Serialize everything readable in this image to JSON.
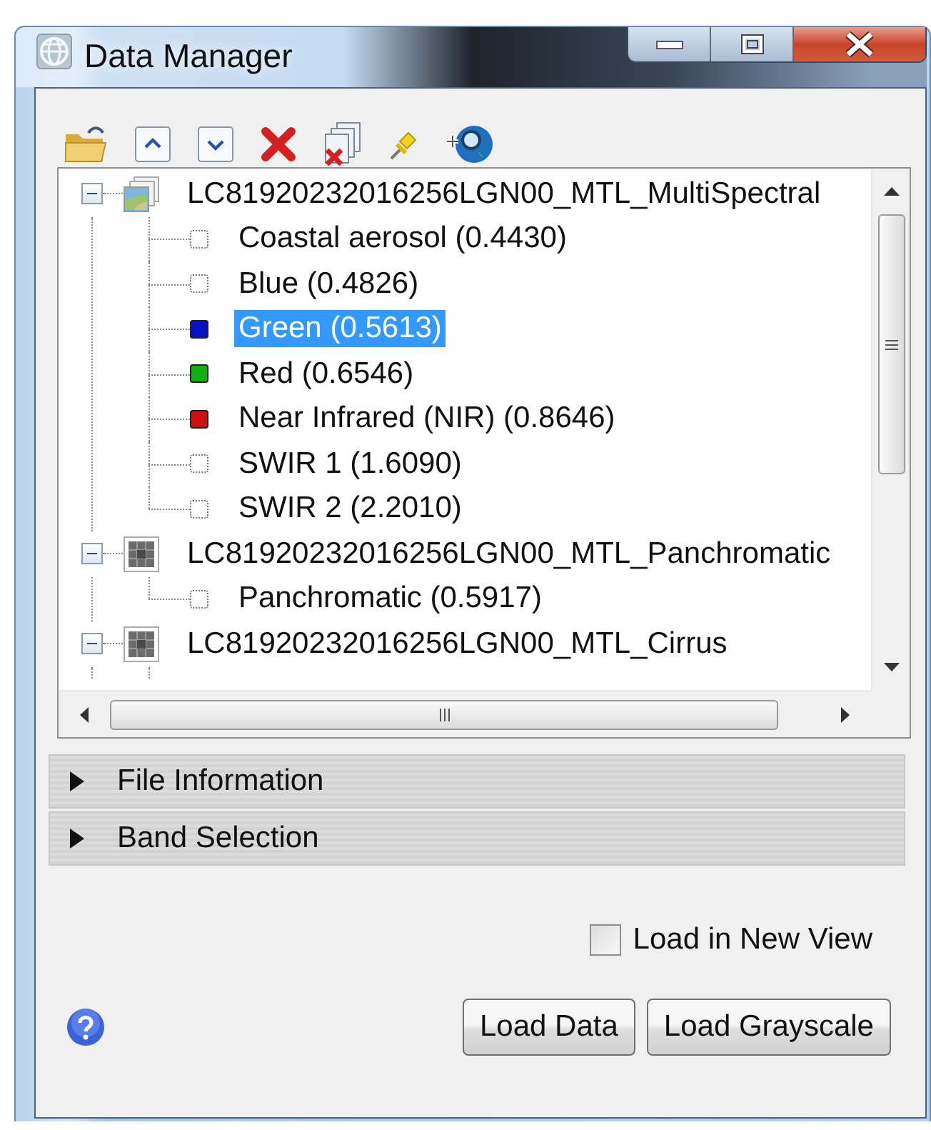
{
  "window": {
    "title": "Data Manager"
  },
  "tree": {
    "datasets": [
      {
        "name": "LC81920232016256LGN00_MTL_MultiSpectral",
        "kind": "multispectral",
        "expanded": true,
        "children": [
          {
            "name": "Coastal aerosol (0.4430)",
            "selected": false
          },
          {
            "name": "Blue (0.4826)",
            "selected": false
          },
          {
            "name": "Green (0.5613)",
            "color": "#0a10c8",
            "selected": true
          },
          {
            "name": "Red (0.6546)",
            "color": "#10b010",
            "selected": false
          },
          {
            "name": "Near Infrared (NIR) (0.8646)",
            "color": "#d01010",
            "selected": false
          },
          {
            "name": "SWIR 1 (1.6090)",
            "selected": false
          },
          {
            "name": "SWIR 2 (2.2010)",
            "selected": false
          }
        ]
      },
      {
        "name": "LC81920232016256LGN00_MTL_Panchromatic",
        "kind": "grayscale",
        "expanded": true,
        "children": [
          {
            "name": "Panchromatic (0.5917)",
            "selected": false
          }
        ]
      },
      {
        "name": "LC81920232016256LGN00_MTL_Cirrus",
        "kind": "grayscale",
        "expanded": true
      }
    ]
  },
  "sections": [
    {
      "label": "File Information",
      "expanded": false
    },
    {
      "label": "Band Selection",
      "expanded": false
    }
  ],
  "load_in_new_view": {
    "label": "Load in New View",
    "checked": false
  },
  "buttons": [
    {
      "label": "Load Data"
    },
    {
      "label": "Load Grayscale"
    }
  ]
}
